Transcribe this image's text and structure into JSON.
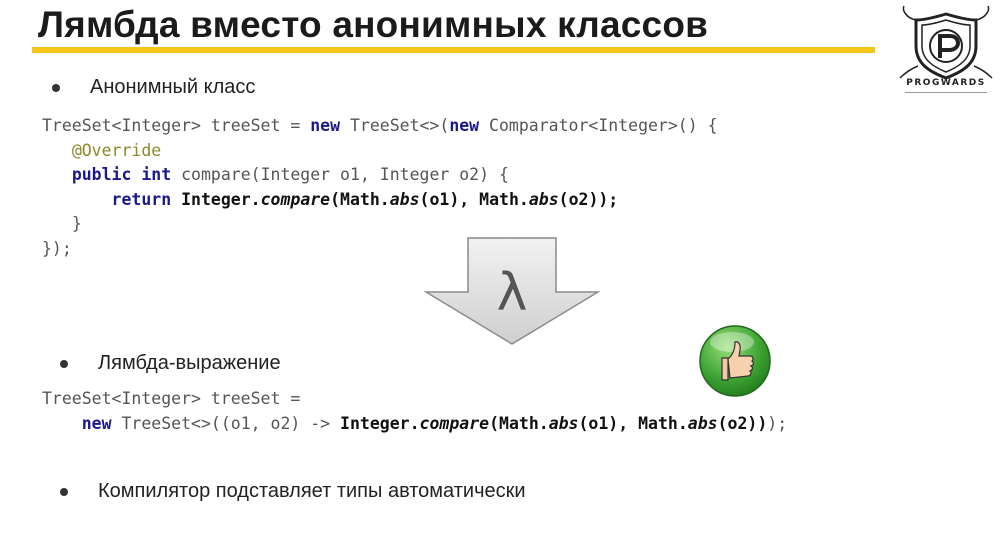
{
  "slide": {
    "title": "Лямбда вместо анонимных классов",
    "logo_text": "PROGWARDS",
    "bullets": [
      "Анонимный класс",
      "Лямбда-выражение",
      "Компилятор подставляет типы автоматически"
    ],
    "arrow_symbol": "λ",
    "colors": {
      "accent_bar": "#f5c518",
      "keyword": "#1a1a8c",
      "annotation": "#8a8a2a",
      "thumb_green": "#3fa535"
    },
    "icons": [
      "logo-shield-icon",
      "lambda-arrow-icon",
      "thumbs-up-icon"
    ]
  },
  "code_anon": {
    "l1a": "TreeSet<Integer> treeSet = ",
    "l1kw": "new",
    "l1b": " TreeSet<>(",
    "l1kw2": "new",
    "l1c": " Comparator<Integer>() {",
    "l2": "@Override",
    "l3kw1": "public",
    "l3kw2": "int",
    "l3rest": " compare(Integer o1, Integer o2) {",
    "l4kw": "return",
    "l4a": "Integer.",
    "l4b": "compare",
    "l4c": "(Math.",
    "l4d": "abs",
    "l4e": "(o1), Math.",
    "l4f": "abs",
    "l4g": "(o2));",
    "l5": "}",
    "l6": "});"
  },
  "code_lambda": {
    "l1": "TreeSet<Integer> treeSet =",
    "l2kw": "new",
    "l2a": " TreeSet<>((o1, o2) -> ",
    "l2b": "Integer.",
    "l2c": "compare",
    "l2d": "(Math.",
    "l2e": "abs",
    "l2f": "(o1), Math.",
    "l2g": "abs",
    "l2h": "(o2))",
    "l2i": ");"
  }
}
